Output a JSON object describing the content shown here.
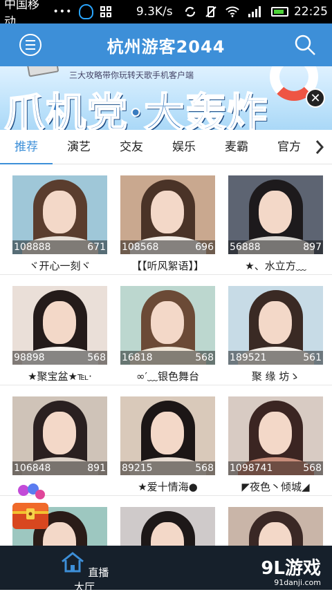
{
  "status_bar": {
    "carrier": "中国移动",
    "dots": "•••",
    "speed": "9.3K/s",
    "time": "22:25",
    "battery_level": 0.8
  },
  "header": {
    "title": "杭州游客2044",
    "menu_icon": "menu-icon",
    "search_icon": "search-icon"
  },
  "banner": {
    "subtitle": "三大攻略带你玩转天歌手机客户端",
    "headline": "爪机党·大轰炸",
    "close_icon": "close-icon"
  },
  "tabs": [
    {
      "label": "推荐",
      "active": true
    },
    {
      "label": "演艺",
      "active": false
    },
    {
      "label": "交友",
      "active": false
    },
    {
      "label": "娱乐",
      "active": false
    },
    {
      "label": "麦霸",
      "active": false
    },
    {
      "label": "官方",
      "active": false
    }
  ],
  "rooms": [
    {
      "id": "108888",
      "count": "671",
      "name": "ヾ开心一刻ヾ",
      "bg": "#9fc7d8",
      "hair": "#5a3d2e",
      "top": "#e8e0d8"
    },
    {
      "id": "108568",
      "count": "696",
      "name": "【【听风絮语】】",
      "bg": "#c9a88f",
      "hair": "#4a3327",
      "top": "#f2ece6"
    },
    {
      "id": "56888",
      "count": "897",
      "name": "★、水立方﹏",
      "bg": "#5d6472",
      "hair": "#1d1a1c",
      "top": "#d9d6d2"
    },
    {
      "id": "98898",
      "count": "568",
      "name": "★聚宝盆★℡·",
      "bg": "#eadfd8",
      "hair": "#241b1a",
      "top": "#f6f2ee"
    },
    {
      "id": "16818",
      "count": "568",
      "name": "∞′﹏银色舞台",
      "bg": "#bcd7cf",
      "hair": "#6b4a36",
      "top": "#efe5d6"
    },
    {
      "id": "189521",
      "count": "561",
      "name": "聚 缘 坊ゝ",
      "bg": "#c7dbe6",
      "hair": "#3a2a24",
      "top": "#f4eee8"
    },
    {
      "id": "106848",
      "count": "891",
      "name": "",
      "bg": "#cfc3b8",
      "hair": "#2a2020",
      "top": "#ddd2c8"
    },
    {
      "id": "89215",
      "count": "568",
      "name": "★爱十情海●",
      "bg": "#d9c9ba",
      "hair": "#1c1616",
      "top": "#e8dcd2"
    },
    {
      "id": "1098741",
      "count": "568",
      "name": "◤夜色丶倾城◢",
      "bg": "#d8cbc3",
      "hair": "#3b2522",
      "top": "#c78d7a"
    },
    {
      "id": "",
      "count": "",
      "name": "",
      "bg": "#9dc7c0",
      "hair": "#2a1c18",
      "top": "#e7dcd0"
    },
    {
      "id": "",
      "count": "",
      "name": "",
      "bg": "#cfcaca",
      "hair": "#1d1818",
      "top": "#e0d8d0"
    },
    {
      "id": "",
      "count": "",
      "name": "",
      "bg": "#c9b5a8",
      "hair": "#3a2825",
      "top": "#e4d6ca"
    }
  ],
  "bottom_nav": {
    "home_label": "直播大厅",
    "watermark": "9L游戏",
    "watermark_url": "91danji.com"
  },
  "colors": {
    "header": "#3d8fd8",
    "tab_active": "#3d8fd8",
    "bottom_bar": "#16202b"
  }
}
